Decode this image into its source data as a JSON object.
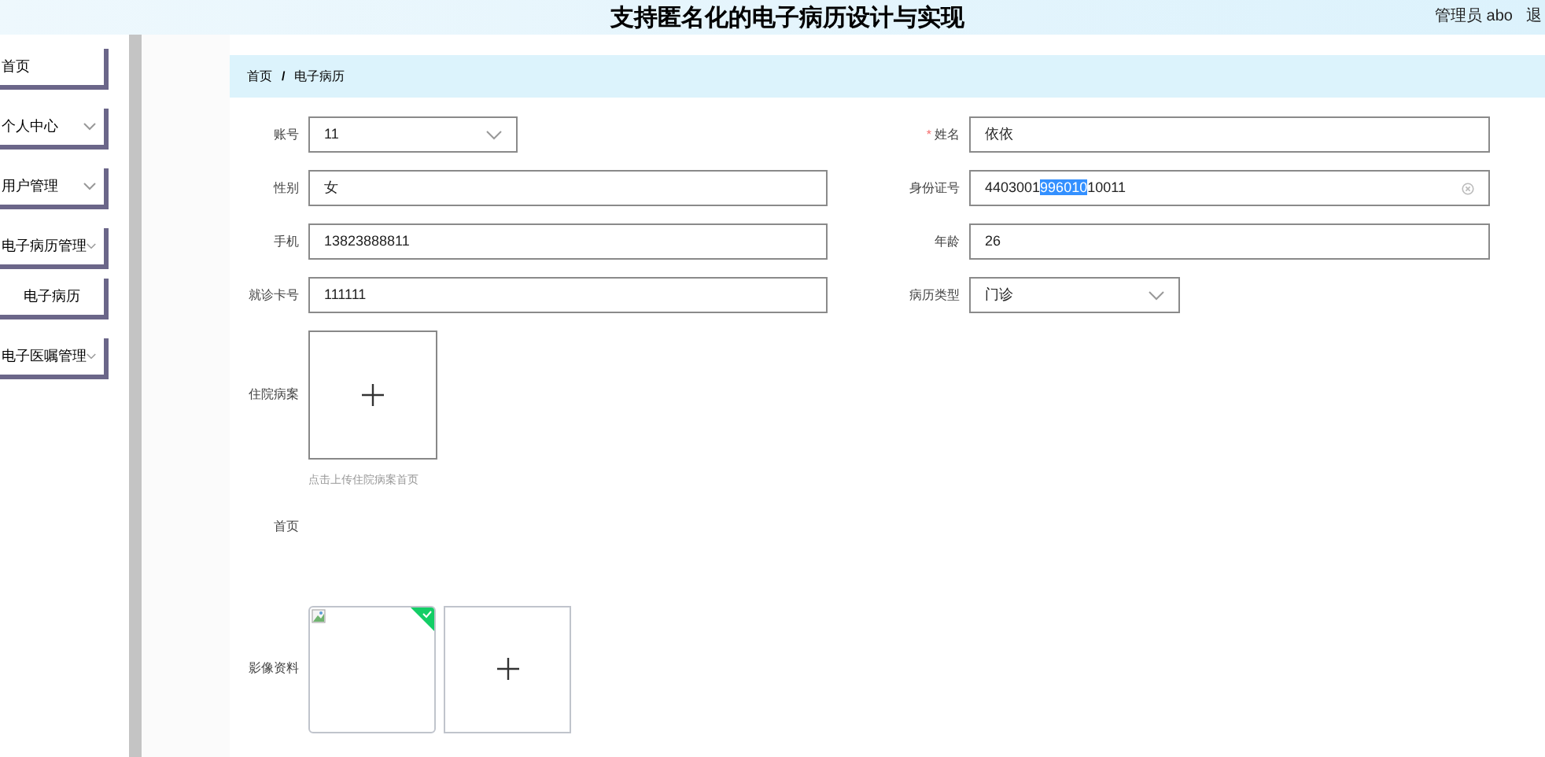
{
  "header": {
    "title": "支持匿名化的电子病历设计与实现",
    "user": "管理员 abo",
    "logout": "退"
  },
  "sidebar": {
    "items": [
      {
        "label": "首页",
        "expandable": false
      },
      {
        "label": "个人中心",
        "expandable": true
      },
      {
        "label": "用户管理",
        "expandable": true
      },
      {
        "label": "电子病历管理",
        "expandable": true,
        "children": [
          {
            "label": "电子病历"
          }
        ]
      },
      {
        "label": "电子医嘱管理",
        "expandable": true
      }
    ]
  },
  "breadcrumb": [
    "首页",
    "电子病历"
  ],
  "breadcrumb_separator": "/",
  "form": {
    "rows": [
      [
        {
          "label": "账号",
          "kind": "select",
          "value": "11"
        },
        {
          "label": "姓名",
          "kind": "input",
          "required_mark": "*",
          "value": "依依"
        }
      ],
      [
        {
          "label": "性别",
          "kind": "input",
          "value": "女"
        },
        {
          "label": "身份证号",
          "kind": "input",
          "clearable": true,
          "value_parts": [
            {
              "text": "4403001",
              "highlighted": false
            },
            {
              "text": "996010",
              "highlighted": true
            },
            {
              "text": "10011",
              "highlighted": false
            }
          ]
        }
      ],
      [
        {
          "label": "手机",
          "kind": "input",
          "value": "13823888811"
        },
        {
          "label": "年龄",
          "kind": "input",
          "value": "26"
        }
      ],
      [
        {
          "label": "就诊卡号",
          "kind": "input",
          "value": "111111"
        },
        {
          "label": "病历类型",
          "kind": "select",
          "value": "门诊"
        }
      ]
    ],
    "cover": {
      "label": "住院病案",
      "hint": "点击上传住院病案首页"
    },
    "first_page": {
      "label": "首页"
    },
    "images": {
      "label": "影像资料",
      "items": [
        {
          "kind": "uploaded",
          "success": true
        },
        {
          "kind": "add"
        }
      ]
    }
  }
}
